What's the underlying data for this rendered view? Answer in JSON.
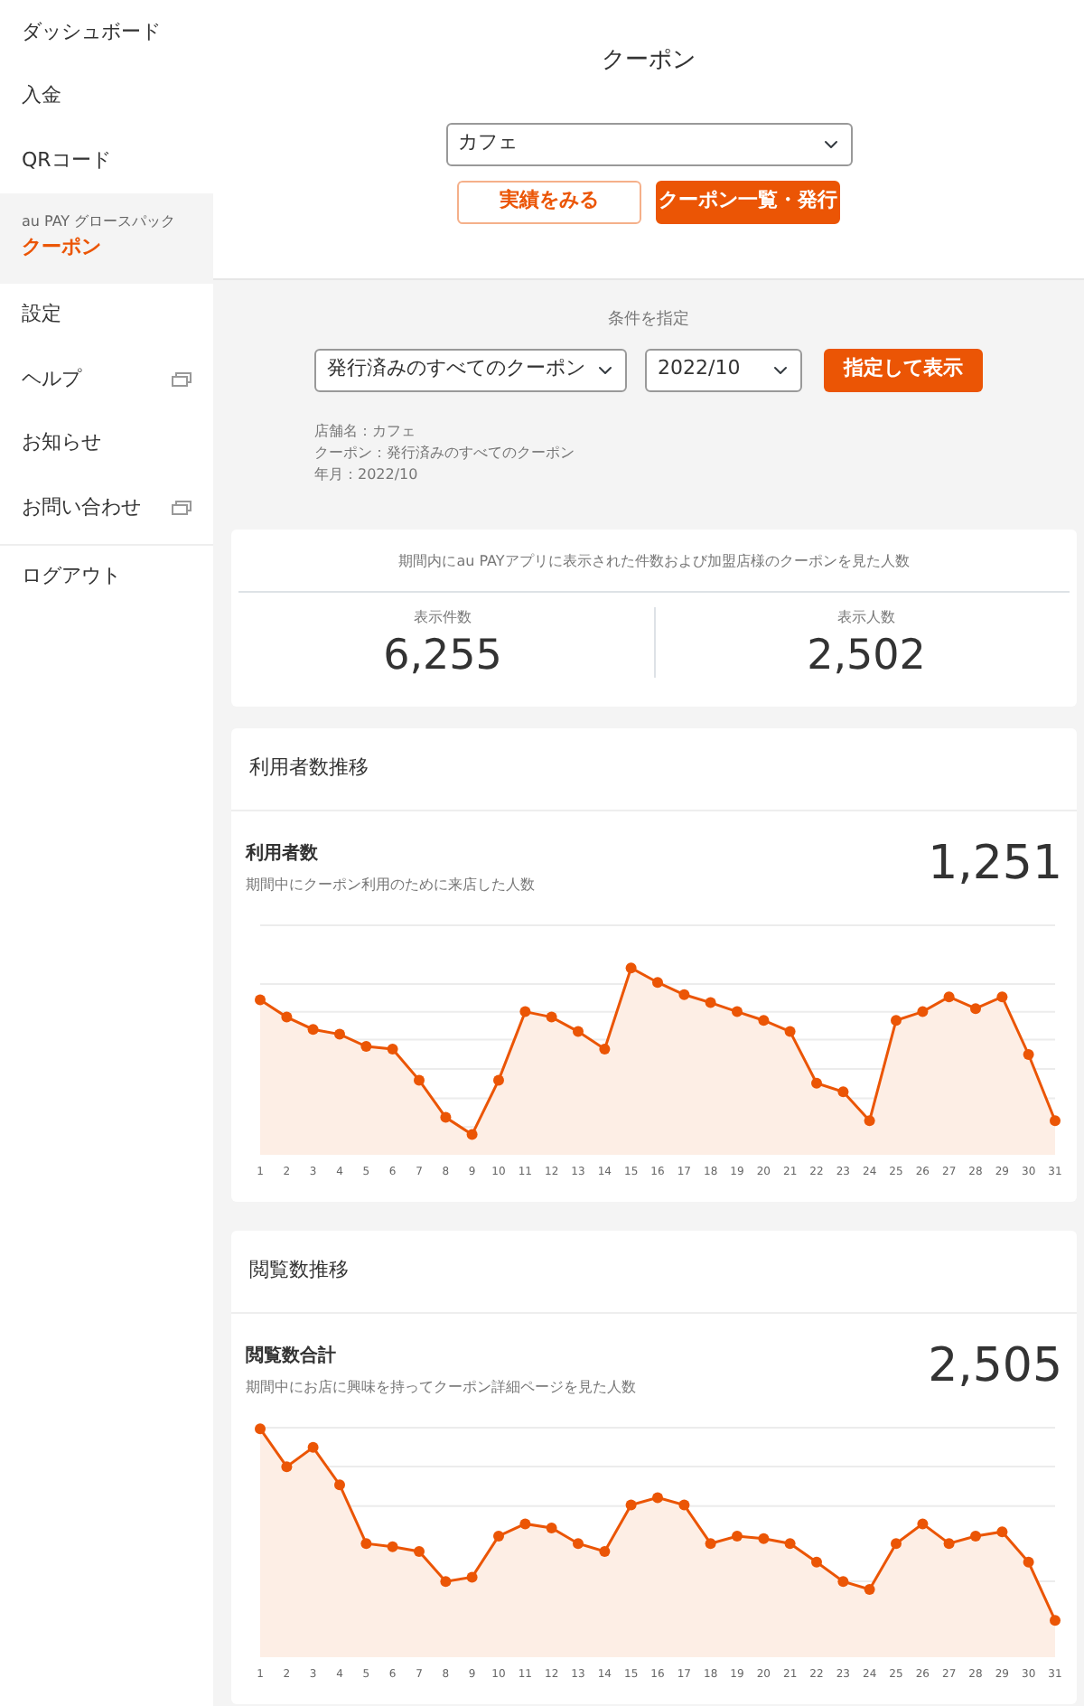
{
  "sidebar": {
    "items": [
      {
        "kind": "link",
        "label": "ダッシュボード",
        "selected": false
      },
      {
        "kind": "link",
        "label": "入金",
        "selected": false
      },
      {
        "kind": "link",
        "label": "QRコード",
        "selected": false
      },
      {
        "kind": "group",
        "caption": "au PAY グロースパック",
        "label": "クーポン",
        "selected": true
      },
      {
        "kind": "link",
        "label": "設定",
        "selected": false
      },
      {
        "kind": "external",
        "label": "ヘルプ",
        "selected": false
      },
      {
        "kind": "link",
        "label": "お知らせ",
        "selected": false
      },
      {
        "kind": "external",
        "label": "お問い合わせ",
        "selected": false
      },
      {
        "kind": "divider_link",
        "label": "ログアウト",
        "selected": false
      }
    ]
  },
  "page_title": "クーポン",
  "store_select": {
    "value": "カフェ"
  },
  "tabs": [
    {
      "label": "実績をみる",
      "selected": false
    },
    {
      "label": "クーポン一覧・発行",
      "selected": true
    }
  ],
  "conditions": {
    "title": "条件を指定",
    "coupon_select": {
      "value": "発行済みのすべてのクーポン"
    },
    "month_select": {
      "value": "2022/10"
    },
    "submit": "指定して表示",
    "summary": [
      "店舗名：カフェ",
      "クーポン：発行済みのすべてのクーポン",
      "年月：2022/10"
    ]
  },
  "impressions": {
    "description": "期間内にau PAYアプリに表示された件数および加盟店様のクーポンを見た人数",
    "stats": [
      {
        "label": "表示件数",
        "value": "6,255"
      },
      {
        "label": "表示人数",
        "value": "2,502"
      }
    ]
  },
  "charts": [
    {
      "title": "利用者数推移",
      "metric": "利用者数",
      "description": "期間中にクーポン利用のために来店した人数",
      "total": "1,251",
      "x_labels": [
        "1",
        "2",
        "3",
        "4",
        "5",
        "6",
        "7",
        "8",
        "9",
        "10",
        "11",
        "12",
        "13",
        "14",
        "15",
        "16",
        "17",
        "18",
        "19",
        "20",
        "21",
        "22",
        "23",
        "24",
        "25",
        "26",
        "27",
        "28",
        "29",
        "30",
        "31"
      ]
    },
    {
      "title": "閲覧数推移",
      "metric": "閲覧数合計",
      "description": "期間中にお店に興味を持ってクーポン詳細ページを見た人数",
      "total": "2,505",
      "x_labels": [
        "1",
        "2",
        "3",
        "4",
        "5",
        "6",
        "7",
        "8",
        "9",
        "10",
        "11",
        "12",
        "13",
        "14",
        "15",
        "16",
        "17",
        "18",
        "19",
        "20",
        "21",
        "22",
        "23",
        "24",
        "25",
        "26",
        "27",
        "28",
        "29",
        "30",
        "31"
      ]
    }
  ]
}
